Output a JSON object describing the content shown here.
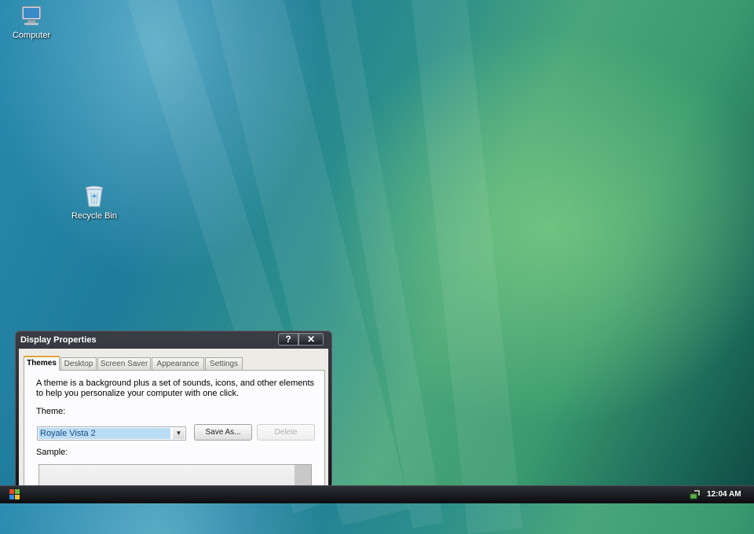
{
  "desktop": {
    "icons": [
      {
        "label": "Computer",
        "icon": "computer-icon"
      },
      {
        "label": "Recycle Bin",
        "icon": "recycle-bin-icon"
      }
    ]
  },
  "dialog": {
    "title": "Display Properties",
    "help_label": "?",
    "close_label": "✕",
    "tabs": [
      {
        "label": "Themes",
        "active": true
      },
      {
        "label": "Desktop",
        "active": false
      },
      {
        "label": "Screen Saver",
        "active": false
      },
      {
        "label": "Appearance",
        "active": false
      },
      {
        "label": "Settings",
        "active": false
      }
    ],
    "description": "A theme is a background plus a set of sounds, icons, and other elements to help you personalize your computer with one click.",
    "theme_label": "Theme:",
    "theme_value": "Royale Vista 2",
    "save_as_label": "Save As...",
    "delete_label": "Delete",
    "sample_label": "Sample:"
  },
  "taskbar": {
    "clock": "12:04 AM"
  },
  "colors": {
    "accent_tab": "#e6a23a",
    "selection": "#b9dcf4"
  }
}
